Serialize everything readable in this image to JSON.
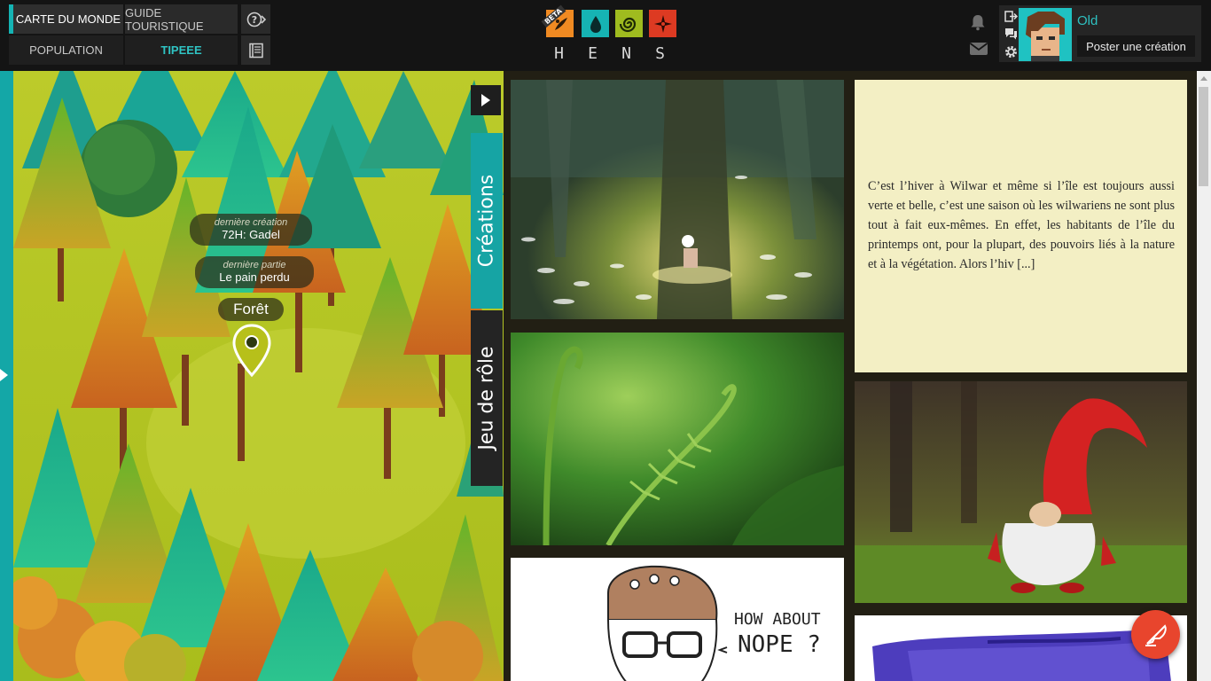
{
  "nav": {
    "carte": "CARTE DU MONDE",
    "guide": "GUIDE TOURISTIQUE",
    "population": "POPULATION",
    "tipeee": "TIPEEE",
    "help_icon": "help-question-icon",
    "page_icon": "notebook-icon"
  },
  "logo": {
    "beta": "BETA",
    "letters": [
      "H",
      "E",
      "N",
      "S"
    ],
    "tiles": [
      {
        "color": "#f08a22",
        "icon": "season-autumn-icon"
      },
      {
        "color": "#16b3b3",
        "icon": "season-winter-drop-icon"
      },
      {
        "color": "#9fbb1f",
        "icon": "season-spring-spiral-icon"
      },
      {
        "color": "#dd3a22",
        "icon": "season-summer-compass-icon"
      }
    ]
  },
  "user": {
    "name": "Old",
    "post_button": "Poster une création",
    "icons": [
      "logout-icon",
      "chat-icon",
      "settings-icon",
      "bell-icon",
      "mail-icon"
    ]
  },
  "map": {
    "last_creation_label": "dernière création",
    "last_creation": "72H: Gadel",
    "last_game_label": "dernière partie",
    "last_game": "Le pain perdu",
    "place": "Forêt"
  },
  "tabs": {
    "creations": "Créations",
    "jeu": "Jeu de rôle"
  },
  "feed": {
    "text_card": "C’est l’hiver à Wilwar et même si l’île est toujours aussi verte et belle, c’est une saison où les wilwariens ne sont plus tout à fait eux-mêmes. En effet, les habitants de l’île du printemps ont, pour la plupart, des pouvoirs liés à la nature et à la végétation. Alors l’hiv [...]",
    "drawing_caption_1": "HOW ABOUT",
    "drawing_caption_2": "NOPE ?"
  },
  "colors": {
    "accent": "#15b3b3",
    "topbar": "#141414",
    "text_card_bg": "#f3efc4",
    "fab": "#e8452d"
  }
}
